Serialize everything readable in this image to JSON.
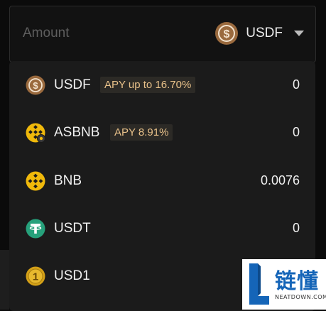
{
  "amount": {
    "label": "Amount",
    "selected_token": "USDF"
  },
  "tokens": [
    {
      "symbol": "USDF",
      "apy": "APY up to 16.70%",
      "balance": "0",
      "icon": "usdf-coin-icon"
    },
    {
      "symbol": "ASBNB",
      "apy": "APY 8.91%",
      "balance": "0",
      "icon": "asbnb-coin-icon"
    },
    {
      "symbol": "BNB",
      "apy": "",
      "balance": "0.0076",
      "icon": "bnb-coin-icon"
    },
    {
      "symbol": "USDT",
      "apy": "",
      "balance": "0",
      "icon": "usdt-coin-icon"
    },
    {
      "symbol": "USD1",
      "apy": "",
      "balance": "",
      "icon": "usd1-coin-icon"
    }
  ],
  "watermark": {
    "chinese": "链懂",
    "english": "NEATDOWN.COM"
  },
  "colors": {
    "apy_text": "#e8c18a",
    "usdf_brown": "#9a6a3e",
    "bnb_yellow": "#f0b90b",
    "usdt_teal": "#26a17b",
    "usd1_gold": "#d4a017",
    "watermark_blue": "#1565b8"
  }
}
